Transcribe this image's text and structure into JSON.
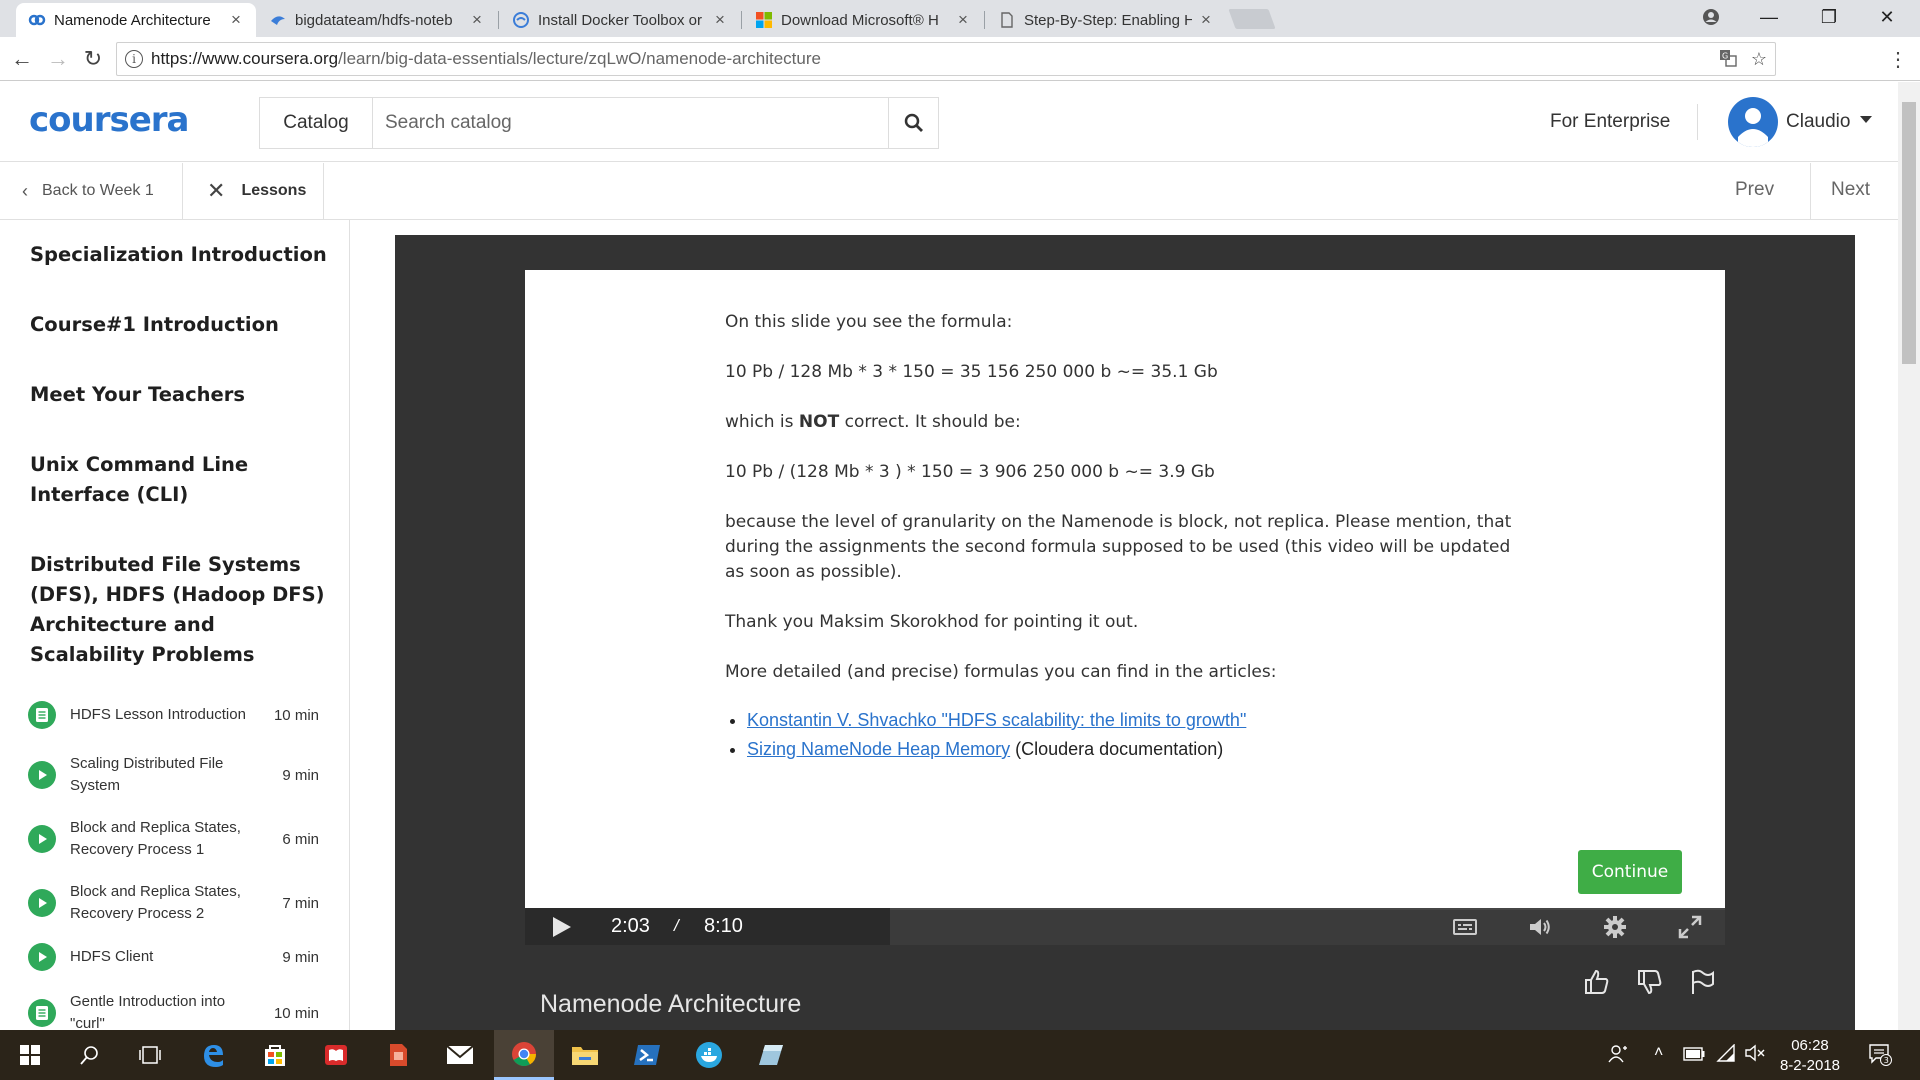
{
  "browser": {
    "tabs": [
      {
        "title": "Namenode Architecture",
        "active": true
      },
      {
        "title": "bigdatateam/hdfs-noteb",
        "active": false
      },
      {
        "title": "Install Docker Toolbox or",
        "active": false
      },
      {
        "title": "Download Microsoft® H",
        "active": false
      },
      {
        "title": "Step-By-Step: Enabling H",
        "active": false
      }
    ],
    "url_host": "https://www.coursera.org",
    "url_path": "/learn/big-data-essentials/lecture/zqLwO/namenode-architecture"
  },
  "header": {
    "logo": "coursera",
    "catalog_label": "Catalog",
    "search_placeholder": "Search catalog",
    "enterprise_label": "For Enterprise",
    "user_name": "Claudio"
  },
  "lesson_nav": {
    "back_label": "Back to Week 1",
    "lessons_label": "Lessons",
    "prev_label": "Prev",
    "next_label": "Next"
  },
  "sidebar": {
    "modules": [
      "Specialization Introduction",
      "Course#1 Introduction",
      "Meet Your Teachers",
      "Unix Command Line Interface (CLI)",
      "Distributed File Systems (DFS), HDFS (Hadoop DFS) Architecture and Scalability Problems"
    ],
    "items": [
      {
        "label": "HDFS Lesson Introduction",
        "duration": "10 min",
        "type": "reading"
      },
      {
        "label": "Scaling Distributed File System",
        "duration": "9 min",
        "type": "video"
      },
      {
        "label": "Block and Replica States, Recovery Process 1",
        "duration": "6 min",
        "type": "video"
      },
      {
        "label": "Block and Replica States, Recovery Process 2",
        "duration": "7 min",
        "type": "video"
      },
      {
        "label": "HDFS Client",
        "duration": "9 min",
        "type": "video"
      },
      {
        "label": "Gentle Introduction into \"curl\"",
        "duration": "10 min",
        "type": "reading"
      }
    ]
  },
  "slide": {
    "p1": "On this slide you see the formula:",
    "p2": "10 Pb / 128 Mb * 3 * 150 = 35 156 250 000 b ~= 35.1 Gb",
    "p3_pre": "which is ",
    "p3_bold": "NOT",
    "p3_post": " correct. It should be:",
    "p4": "10 Pb / (128 Mb * 3 ) * 150 = 3 906 250 000 b ~= 3.9 Gb",
    "p5": "because the level of granularity on the Namenode is block, not replica. Please mention, that during the assignments the second formula supposed to be used (this video will be updated as soon as possible).",
    "p6": "Thank you Maksim Skorokhod for pointing it out.",
    "p7": "More detailed (and precise) formulas you can find in the articles:",
    "link1": "Konstantin V. Shvachko \"HDFS scalability: the limits to growth\"",
    "link2": "Sizing NameNode Heap Memory",
    "link2_suffix": " (Cloudera documentation)",
    "continue_label": "Continue"
  },
  "player": {
    "current_time": "2:03",
    "separator": "/",
    "total_time": "8:10",
    "title": "Namenode Architecture"
  },
  "taskbar": {
    "time": "06:28",
    "date": "8-2-2018",
    "notifications": "3"
  },
  "colors": {
    "brand_blue": "#2a73cc",
    "continue_green": "#3fad46",
    "item_green": "#2fa95a"
  }
}
